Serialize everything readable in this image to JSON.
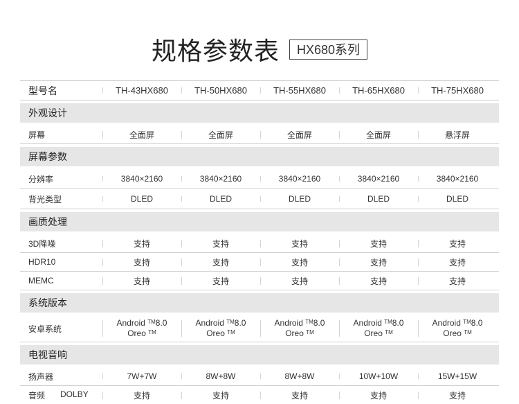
{
  "header": {
    "title": "规格参数表",
    "badge": "HX680系列"
  },
  "columns": {
    "label": "型号名",
    "models": [
      "TH-43HX680",
      "TH-50HX680",
      "TH-55HX680",
      "TH-65HX680",
      "TH-75HX680"
    ]
  },
  "sections": {
    "appearance": {
      "title": "外观设计",
      "screen": {
        "label": "屏幕",
        "values": [
          "全面屏",
          "全面屏",
          "全面屏",
          "全面屏",
          "悬浮屏"
        ]
      }
    },
    "screen_params": {
      "title": "屏幕参数",
      "resolution": {
        "label": "分辨率",
        "values": [
          "3840×2160",
          "3840×2160",
          "3840×2160",
          "3840×2160",
          "3840×2160"
        ]
      },
      "backlight": {
        "label": "背光类型",
        "values": [
          "DLED",
          "DLED",
          "DLED",
          "DLED",
          "DLED"
        ]
      }
    },
    "picture": {
      "title": "画质处理",
      "nr3d": {
        "label": "3D降噪",
        "values": [
          "支持",
          "支持",
          "支持",
          "支持",
          "支持"
        ]
      },
      "hdr10": {
        "label": "HDR10",
        "values": [
          "支持",
          "支持",
          "支持",
          "支持",
          "支持"
        ]
      },
      "memc": {
        "label": "MEMC",
        "values": [
          "支持",
          "支持",
          "支持",
          "支持",
          "支持"
        ]
      }
    },
    "system": {
      "title": "系统版本",
      "android": {
        "label": "安卓系统",
        "line1_prefix": "Android",
        "tm": "TM",
        "line1_suffix": "8.0",
        "line2_prefix": "Oreo",
        "tm2": "TM"
      }
    },
    "audio": {
      "title": "电视音响",
      "speaker": {
        "label": "扬声器",
        "values": [
          "7W+7W",
          "8W+8W",
          "8W+8W",
          "10W+10W",
          "15W+15W"
        ]
      },
      "dolby": {
        "label_a": "音频",
        "label_b": "DOLBY",
        "values": [
          "支持",
          "支持",
          "支持",
          "支持",
          "支持"
        ]
      }
    }
  }
}
